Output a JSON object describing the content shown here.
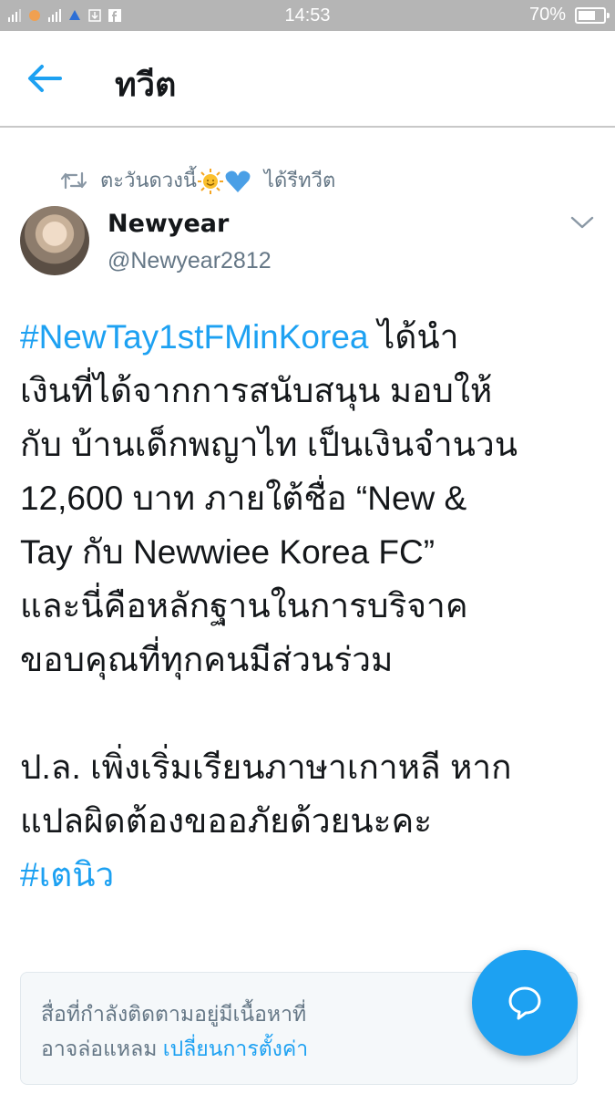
{
  "status_bar": {
    "time": "14:53",
    "battery_text": "70%",
    "battery_level": 0.7
  },
  "header": {
    "title": "ทวีต",
    "back_icon": "back-arrow-icon"
  },
  "retweet": {
    "user": "ตะวันดวงนี้",
    "emojis": [
      "sun-emoji",
      "blue-heart-emoji"
    ],
    "action": "ได้รีทวีต"
  },
  "author": {
    "name": "Newyear",
    "handle": "@Newyear2812"
  },
  "tweet": {
    "hashtag1": "#NewTay1stFMinKorea",
    "line1_rest": " ได้นำ",
    "line2": "เงินที่ได้จากการสนับสนุน มอบให้",
    "line3": "กับ บ้านเด็กพญาไท เป็นเงินจำนวน",
    "line4": "12,600 บาท ภายใต้ชื่อ “New &",
    "line5": "Tay กับ Newwiee Korea FC”",
    "line6": "และนี่คือหลักฐานในการบริจาค",
    "line7": "ขอบคุณที่ทุกคนมีส่วนร่วม",
    "line8": "ป.ล. เพิ่งเริ่มเรียนภาษาเกาหลี หาก",
    "line9": "แปลผิดต้องขออภัยด้วยนะคะ",
    "hashtag2": "#เตนิว"
  },
  "sensitive_notice": {
    "text1": "สื่อที่กำลังติดตามอยู่มีเนื้อหาที่",
    "text2": "อาจล่อแหลม ",
    "link": "เปลี่ยนการตั้งค่า"
  },
  "fab": {
    "icon": "compose-reply-icon",
    "color": "#1da1f2"
  },
  "colors": {
    "accent": "#1da1f2",
    "secondary_text": "#657786",
    "status_bar": "#b5b5b5"
  }
}
